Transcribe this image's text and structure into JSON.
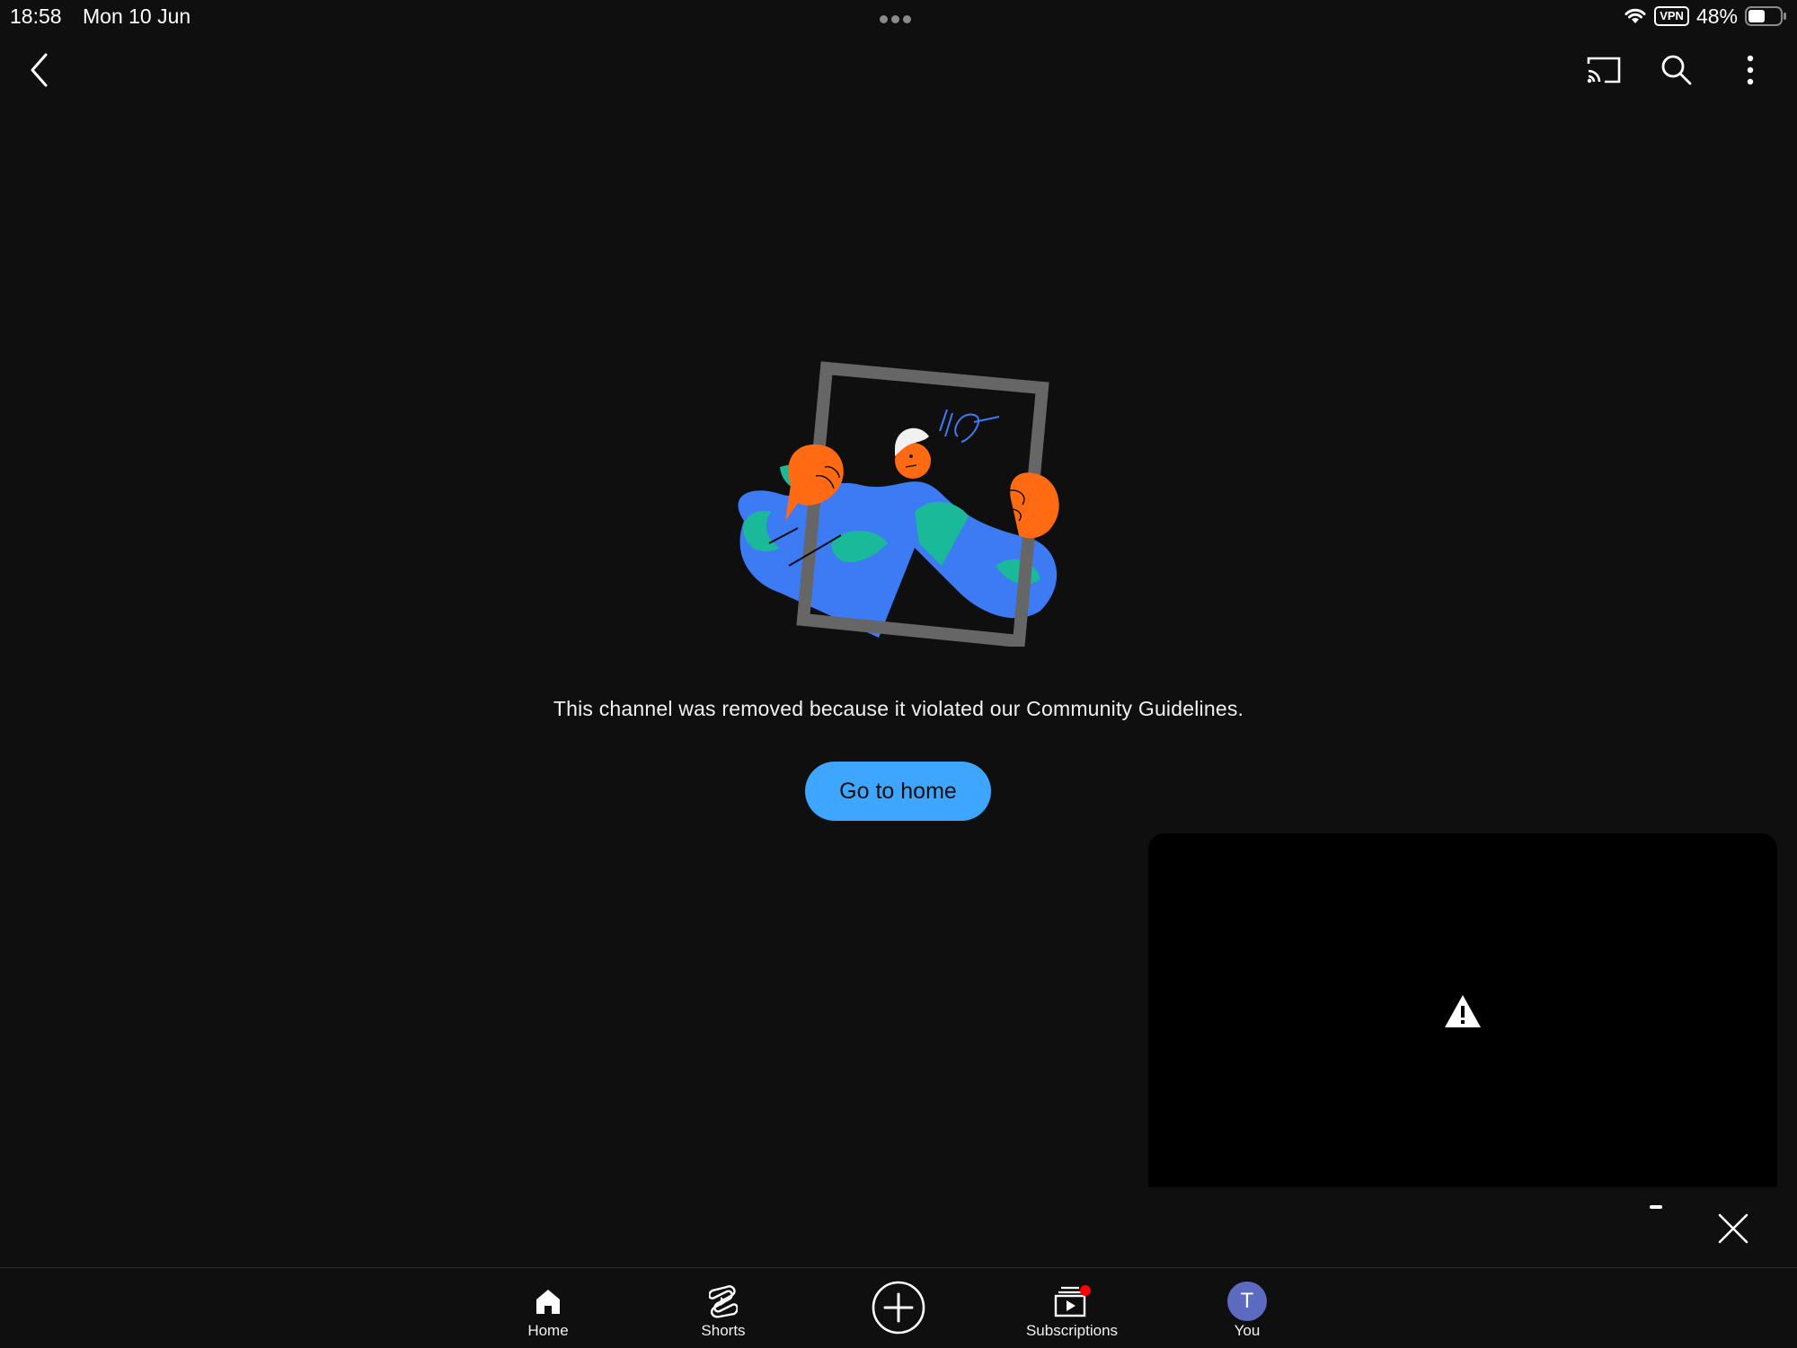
{
  "status_bar": {
    "time": "18:58",
    "date": "Mon 10 Jun",
    "vpn": "VPN",
    "battery": "48%"
  },
  "top_bar": {
    "icons": [
      "back-icon",
      "cast-icon",
      "search-icon",
      "more-vert-icon"
    ]
  },
  "main": {
    "message": "This channel was removed because it violated our Community Guidelines.",
    "home_button_label": "Go to home"
  },
  "miniplayer": {
    "icons": [
      "warning-icon",
      "close-icon"
    ]
  },
  "bottom_nav": {
    "items": [
      {
        "label": "Home",
        "icon": "home-icon"
      },
      {
        "label": "Shorts",
        "icon": "shorts-icon"
      },
      {
        "label": "",
        "icon": "create-icon"
      },
      {
        "label": "Subscriptions",
        "icon": "subscriptions-icon"
      },
      {
        "label": "You",
        "icon": "avatar"
      }
    ],
    "avatar_initial": "T"
  },
  "colors": {
    "background": "#0f0f0f",
    "accent": "#3ea6ff",
    "notification_dot": "#ff0000",
    "avatar": "#5c6bc0"
  }
}
